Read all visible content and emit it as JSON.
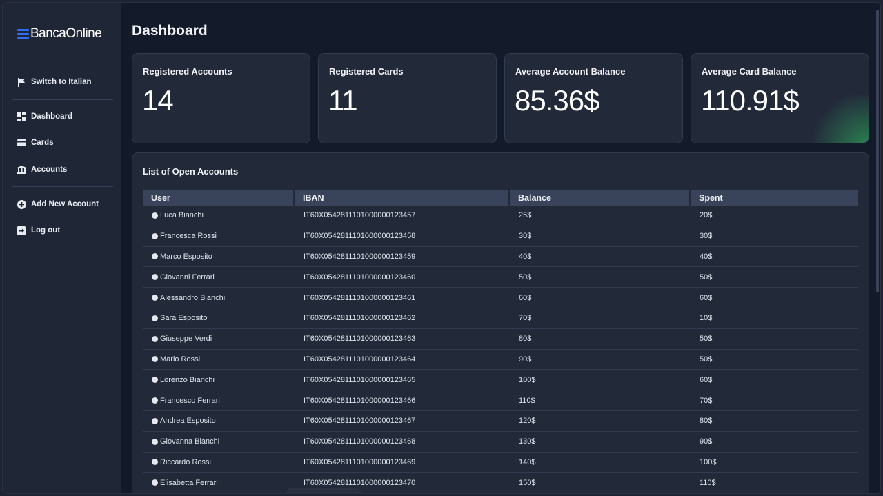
{
  "brand": {
    "name": "BancaOnline",
    "accent": "#2f6df2"
  },
  "sidebar": {
    "language_toggle": "Switch to Italian",
    "items": [
      {
        "label": "Dashboard",
        "icon": "dashboard-icon"
      },
      {
        "label": "Cards",
        "icon": "card-icon"
      },
      {
        "label": "Accounts",
        "icon": "bank-icon"
      }
    ],
    "add_account": "Add New Account",
    "logout": "Log out"
  },
  "header": {
    "title": "Dashboard"
  },
  "stats": [
    {
      "label": "Registered Accounts",
      "value": "14"
    },
    {
      "label": "Registered Cards",
      "value": "11"
    },
    {
      "label": "Average Account Balance",
      "value": "85.36$"
    },
    {
      "label": "Average Card Balance",
      "value": "110.91$"
    }
  ],
  "accounts_table": {
    "title": "List of Open Accounts",
    "columns": [
      "User",
      "IBAN",
      "Balance",
      "Spent"
    ],
    "rows": [
      {
        "user": "Luca Bianchi",
        "iban": "IT60X0542811101000000123457",
        "balance": "25$",
        "spent": "20$"
      },
      {
        "user": "Francesca Rossi",
        "iban": "IT60X0542811101000000123458",
        "balance": "30$",
        "spent": "30$"
      },
      {
        "user": "Marco Esposito",
        "iban": "IT60X0542811101000000123459",
        "balance": "40$",
        "spent": "40$"
      },
      {
        "user": "Giovanni Ferrari",
        "iban": "IT60X0542811101000000123460",
        "balance": "50$",
        "spent": "50$"
      },
      {
        "user": "Alessandro Bianchi",
        "iban": "IT60X0542811101000000123461",
        "balance": "60$",
        "spent": "60$"
      },
      {
        "user": "Sara Esposito",
        "iban": "IT60X0542811101000000123462",
        "balance": "70$",
        "spent": "10$"
      },
      {
        "user": "Giuseppe Verdi",
        "iban": "IT60X0542811101000000123463",
        "balance": "80$",
        "spent": "50$"
      },
      {
        "user": "Mario Rossi",
        "iban": "IT60X0542811101000000123464",
        "balance": "90$",
        "spent": "50$"
      },
      {
        "user": "Lorenzo Bianchi",
        "iban": "IT60X0542811101000000123465",
        "balance": "100$",
        "spent": "60$"
      },
      {
        "user": "Francesco Ferrari",
        "iban": "IT60X0542811101000000123466",
        "balance": "110$",
        "spent": "70$"
      },
      {
        "user": "Andrea Esposito",
        "iban": "IT60X0542811101000000123467",
        "balance": "120$",
        "spent": "80$"
      },
      {
        "user": "Giovanna Bianchi",
        "iban": "IT60X0542811101000000123468",
        "balance": "130$",
        "spent": "90$"
      },
      {
        "user": "Riccardo Rossi",
        "iban": "IT60X0542811101000000123469",
        "balance": "140$",
        "spent": "100$"
      },
      {
        "user": "Elisabetta Ferrari",
        "iban": "IT60X0542811101000000123470",
        "balance": "150$",
        "spent": "110$"
      }
    ]
  }
}
